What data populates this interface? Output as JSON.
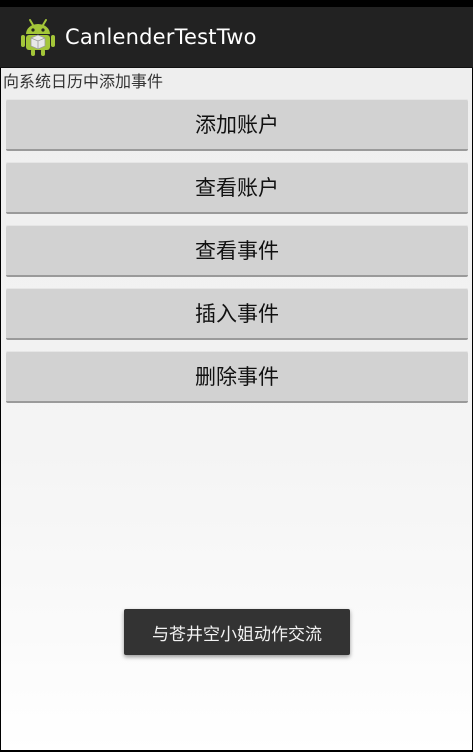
{
  "app": {
    "title": "CanlenderTestTwo",
    "icon": "android-robot-icon"
  },
  "main": {
    "header": "向系统日历中添加事件",
    "buttons": [
      {
        "label": "添加账户"
      },
      {
        "label": "查看账户"
      },
      {
        "label": "查看事件"
      },
      {
        "label": "插入事件"
      },
      {
        "label": "删除事件"
      }
    ]
  },
  "toast": {
    "message": "与苍井空小姐动作交流"
  },
  "colors": {
    "action_bar": "#222222",
    "button_bg": "#d2d2d2",
    "toast_bg": "#333333",
    "android_green": "#a4c639"
  }
}
